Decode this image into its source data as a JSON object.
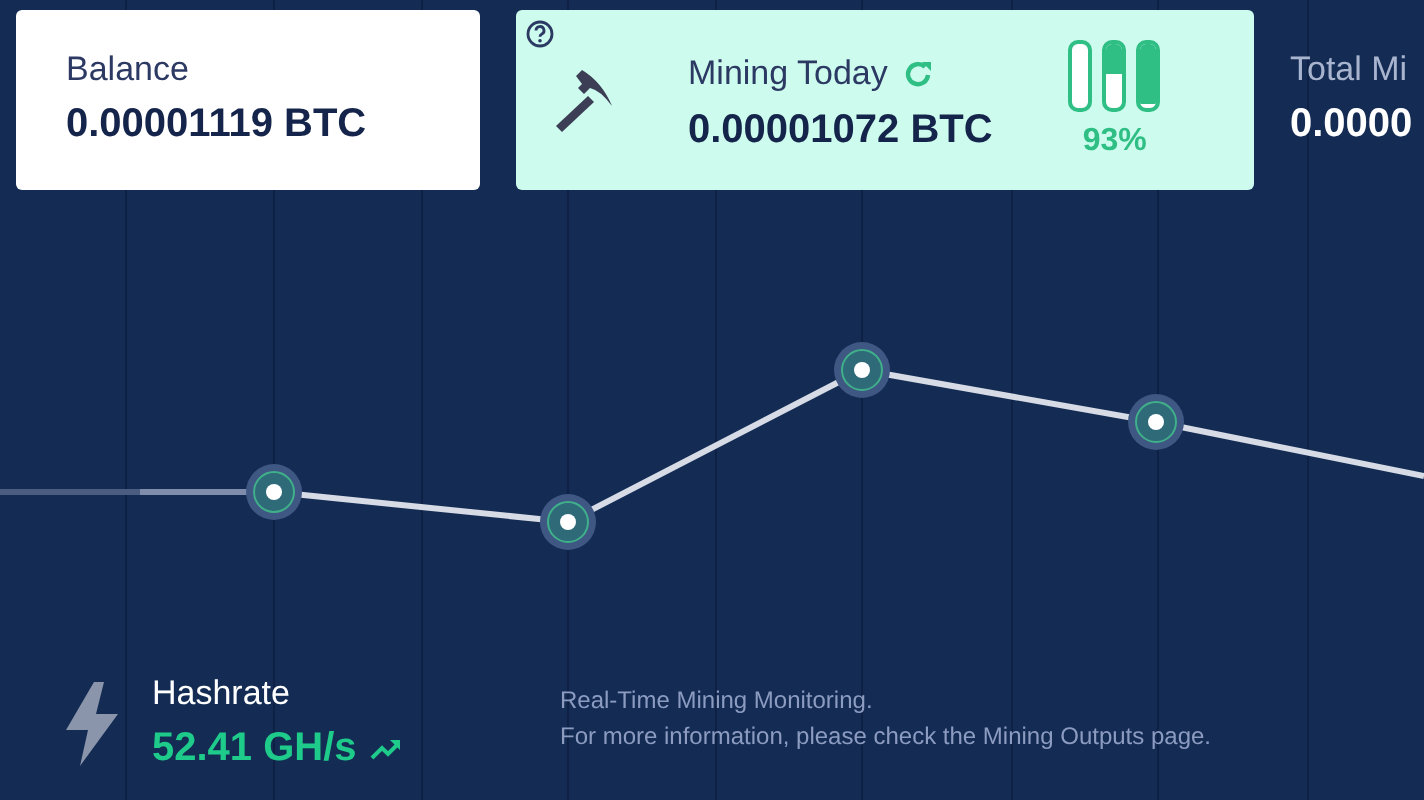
{
  "cards": [
    {
      "kind": "plain",
      "label": "Balance",
      "value": "0.00001119 BTC"
    },
    {
      "kind": "mining",
      "label": "Mining Today",
      "value": "0.00001072 BTC",
      "meter": {
        "level": 0.93,
        "reading": "93%"
      }
    },
    {
      "kind": "clipped",
      "label": "Total Mi",
      "value": "0.0000"
    }
  ],
  "hashrate": {
    "label": "Hashrate",
    "value": "52.41 GH/s"
  },
  "notes": [
    "Real-Time Mining Monitoring.",
    "For more information, please check the Mining Outputs page."
  ]
}
